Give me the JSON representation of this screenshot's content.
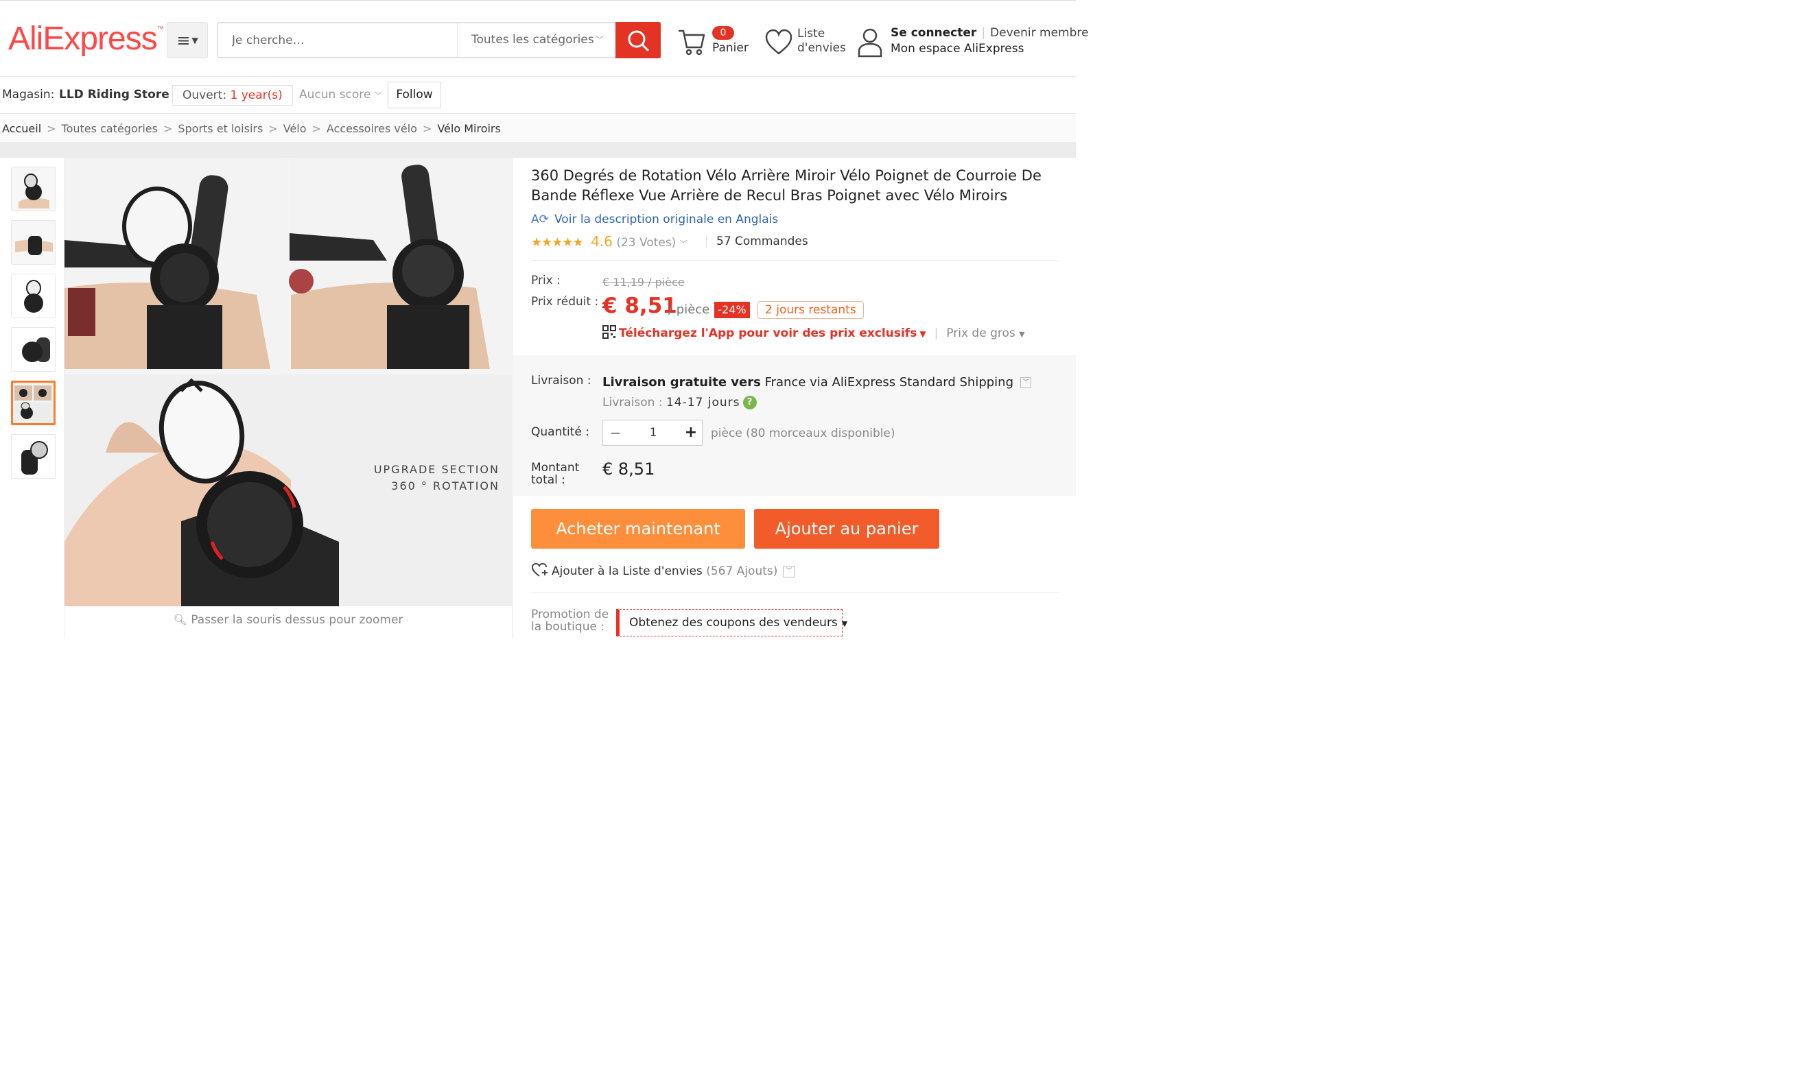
{
  "header": {
    "logo": "AliExpress",
    "logo_tm": "™",
    "search_placeholder": "Je cherche…",
    "category": "Toutes les catégories",
    "cart_count": "0",
    "cart_label": "Panier",
    "wishlist_label": "Liste d'envies",
    "sign_in": "Se connecter",
    "join": "Devenir membre",
    "my_account": "Mon espace AliExpress",
    "brand_color": "#ff4747",
    "search_button_color": "#e43225"
  },
  "store": {
    "label": "Magasin:",
    "name": "LLD Riding Store",
    "open_label": "Ouvert:",
    "open_value": "1 year(s)",
    "score": "Aucun score",
    "follow": "Follow"
  },
  "breadcrumb": [
    "Accueil",
    "Toutes catégories",
    "Sports et loisirs",
    "Vélo",
    "Accessoires vélo",
    "Vélo Miroirs"
  ],
  "gallery": {
    "thumb_count": 6,
    "active_thumb": 5,
    "image_caption_1": "UPGRADE SECTION",
    "image_caption_2": "360 ° ROTATION",
    "zoom_hint": "Passer la souris dessus pour zoomer"
  },
  "product": {
    "title": "360 Degrés de Rotation Vélo Arrière Miroir Vélo Poignet de Courroie De Bande Réflexe Vue Arrière de Recul Bras Poignet avec Vélo Miroirs",
    "original_desc": "Voir la description originale en Anglais",
    "rating_value": 4.6,
    "rating_score": "4.6",
    "votes": "(23 Votes)",
    "orders": "57 Commandes",
    "price_label": "Prix :",
    "old_price": "€ 11,19 / pièce",
    "reduced_label": "Prix réduit :",
    "new_price": "€ 8,51",
    "unit": "/ pièce",
    "discount": "-24%",
    "days_left": "2 jours restants",
    "app_promo": "Téléchargez l'App pour voir des prix exclusifs",
    "wholesale": "Prix de gros",
    "shipping_label": "Livraison :",
    "shipping_bold": "Livraison gratuite vers",
    "shipping_rest": "France via AliExpress Standard Shipping",
    "delivery_label": "Livraison :",
    "delivery_time": "14-17 jours",
    "quantity_label": "Quantité :",
    "quantity": "1",
    "availability": "pièce (80 morceaux disponible)",
    "total_label": "Montant total :",
    "total": "€ 8,51",
    "buy_now": "Acheter maintenant",
    "add_cart": "Ajouter au panier",
    "add_wishlist": "Ajouter à la Liste d'envies",
    "wishlist_count": "(567 Ajouts)",
    "promo_label": "Promotion de la boutique :",
    "promo_value": "Obtenez des coupons des vendeurs"
  }
}
